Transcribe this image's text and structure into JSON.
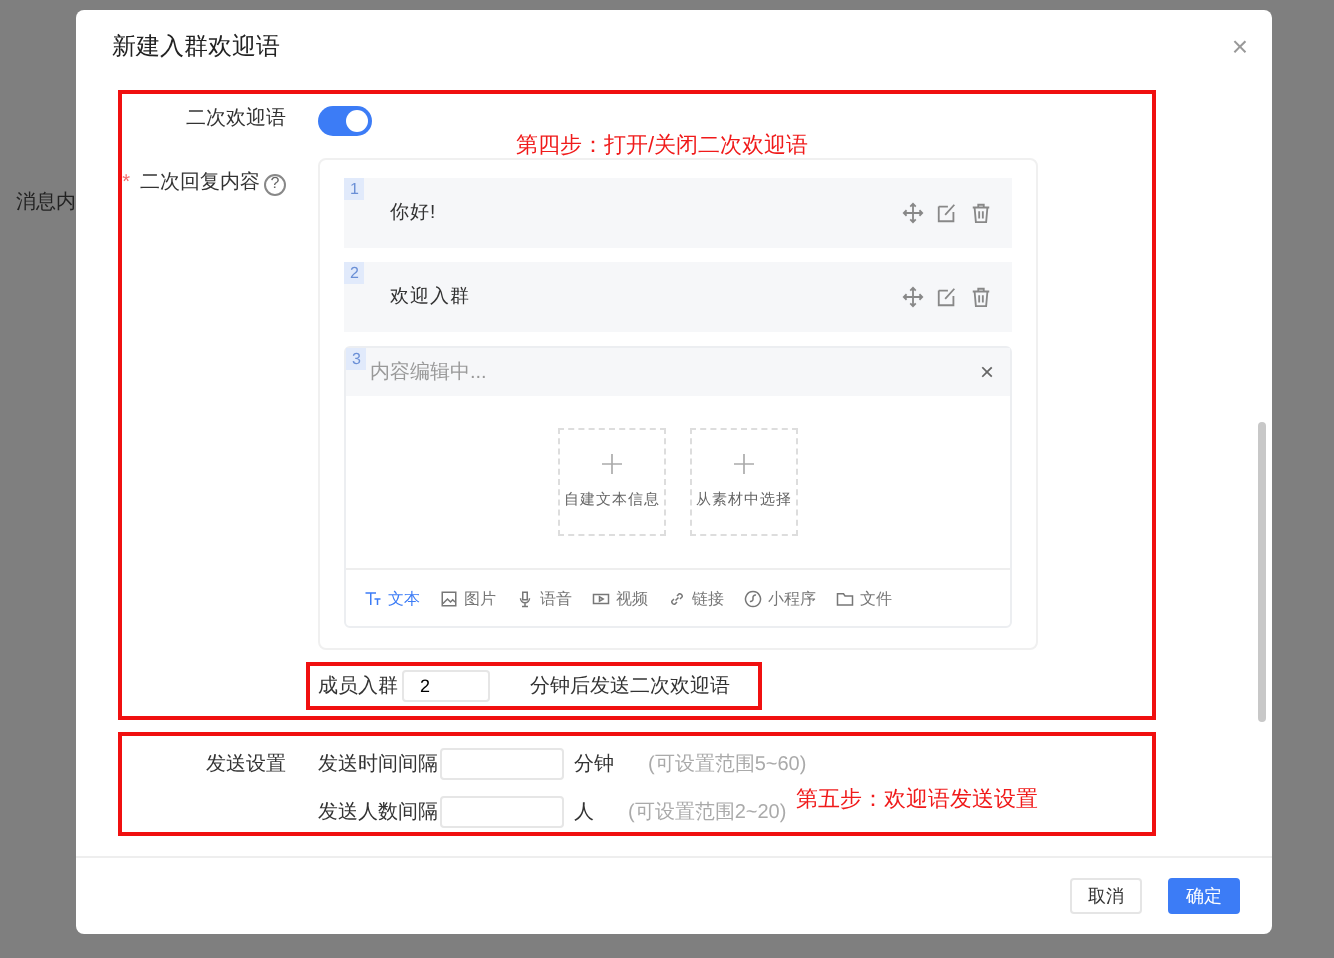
{
  "backdrop": {
    "text": "消息内"
  },
  "dialog": {
    "title": "新建入群欢迎语",
    "close": "×"
  },
  "second_welcome": {
    "label": "二次欢迎语",
    "on": true,
    "annotation": "第四步：打开/关闭二次欢迎语"
  },
  "reply_content": {
    "label": "二次回复内容",
    "required_mark": "*",
    "help": "?",
    "items": [
      {
        "index": "1",
        "text": "你好!"
      },
      {
        "index": "2",
        "text": "欢迎入群"
      }
    ],
    "editor": {
      "index": "3",
      "placeholder": "内容编辑中...",
      "close": "×",
      "options": [
        {
          "label": "自建文本信息"
        },
        {
          "label": "从素材中选择"
        }
      ],
      "types": [
        {
          "kind": "text",
          "label": "文本",
          "selected": true
        },
        {
          "kind": "image",
          "label": "图片",
          "selected": false
        },
        {
          "kind": "voice",
          "label": "语音",
          "selected": false
        },
        {
          "kind": "video",
          "label": "视频",
          "selected": false
        },
        {
          "kind": "link",
          "label": "链接",
          "selected": false
        },
        {
          "kind": "miniprogram",
          "label": "小程序",
          "selected": false
        },
        {
          "kind": "file",
          "label": "文件",
          "selected": false
        }
      ]
    }
  },
  "delay": {
    "prefix": "成员入群",
    "value": "2",
    "suffix": "分钟后发送二次欢迎语"
  },
  "send_settings": {
    "label": "发送设置",
    "annotation": "第五步：欢迎语发送设置",
    "rows": [
      {
        "label": "发送时间间隔",
        "unit": "分钟",
        "hint": "(可设置范围5~60)"
      },
      {
        "label": "发送人数间隔",
        "unit": "人",
        "hint": "(可设置范围2~20)"
      }
    ]
  },
  "buttons": [
    {
      "label": "取消",
      "kind": "default"
    },
    {
      "label": "确定",
      "kind": "primary"
    }
  ]
}
